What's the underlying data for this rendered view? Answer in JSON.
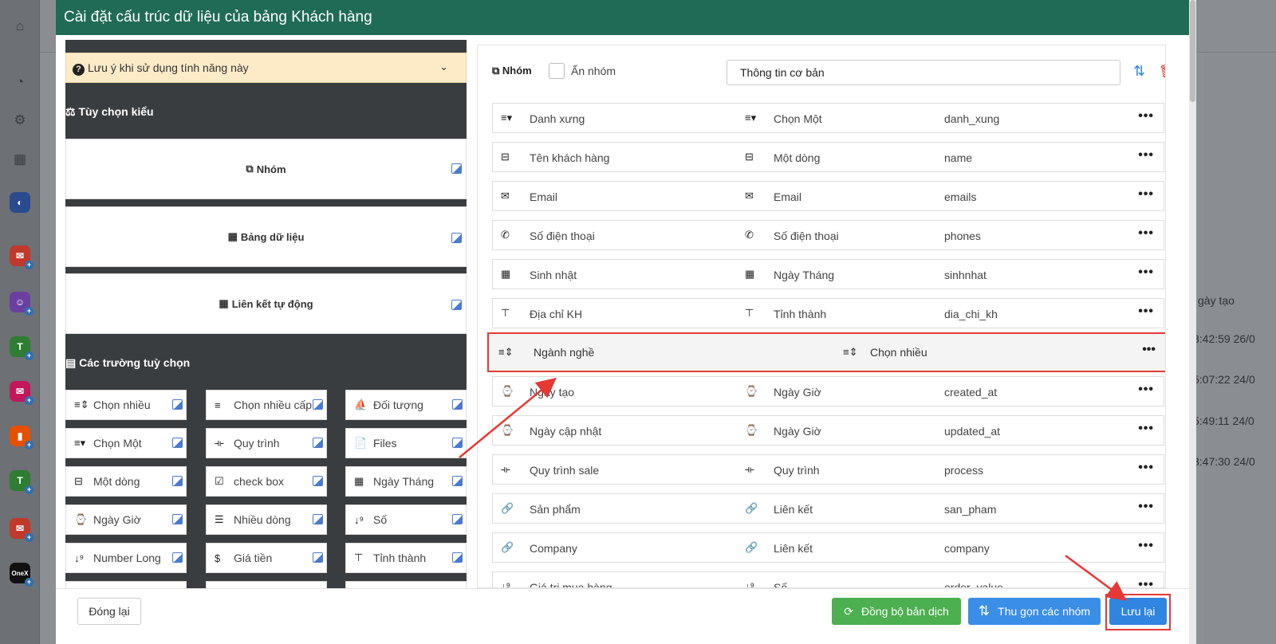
{
  "modal": {
    "title": "Cài đặt cấu trúc dữ liệu của bảng Khách hàng"
  },
  "left_panel": {
    "notice": "Lưu ý khi sử dụng tính năng này",
    "type_section_title": "Tùy chọn kiểu",
    "type_cards": [
      {
        "label": "Nhóm",
        "icon": "copy-icon"
      },
      {
        "label": "Bảng dữ liệu",
        "icon": "table-icon"
      },
      {
        "label": "Liên kết tự động",
        "icon": "table-icon"
      }
    ],
    "fields_section_title": "Các trường tuỳ chọn",
    "field_buttons": [
      {
        "label": "Chọn nhiều",
        "icon": "multi-select-icon"
      },
      {
        "label": "Chọn nhiều cấp",
        "icon": "list-icon"
      },
      {
        "label": "Đối tượng",
        "icon": "sailboat-icon"
      },
      {
        "label": "Chọn Một",
        "icon": "single-select-icon"
      },
      {
        "label": "Quy trình",
        "icon": "process-icon"
      },
      {
        "label": "Files",
        "icon": "file-icon"
      },
      {
        "label": "Một dòng",
        "icon": "single-line-icon"
      },
      {
        "label": "check box",
        "icon": "checkbox-icon"
      },
      {
        "label": "Ngày Tháng",
        "icon": "calendar-icon"
      },
      {
        "label": "Ngày Giờ",
        "icon": "watch-icon"
      },
      {
        "label": "Nhiều dòng",
        "icon": "paragraph-icon"
      },
      {
        "label": "Số",
        "icon": "number-sort-icon"
      },
      {
        "label": "Number Long",
        "icon": "number-sort-icon"
      },
      {
        "label": "Giá tiền",
        "icon": "dollar-icon"
      },
      {
        "label": "Tỉnh thành",
        "icon": "signpost-icon"
      }
    ]
  },
  "right_panel": {
    "group_label": "Nhóm",
    "hide_group_label": "Ẩn nhóm",
    "group_name_value": "Thông tin cơ bản",
    "rows": [
      {
        "name": "Danh xưng",
        "type": "Chọn Một",
        "key": "danh_xung",
        "icon": "single-select-icon"
      },
      {
        "name": "Tên khách hàng",
        "type": "Một dòng",
        "key": "name",
        "icon": "single-line-icon"
      },
      {
        "name": "Email",
        "type": "Email",
        "key": "emails",
        "icon": "envelope-icon"
      },
      {
        "name": "Số điện thoại",
        "type": "Số điện thoại",
        "key": "phones",
        "icon": "phone-icon"
      },
      {
        "name": "Sinh nhật",
        "type": "Ngày Tháng",
        "key": "sinhnhat",
        "icon": "calendar-icon"
      },
      {
        "name": "Địa chỉ KH",
        "type": "Tỉnh thành",
        "key": "dia_chi_kh",
        "icon": "signpost-icon"
      },
      {
        "name": "Ngày tạo",
        "type": "Ngày Giờ",
        "key": "created_at",
        "icon": "watch-icon"
      },
      {
        "name": "Ngày cập nhật",
        "type": "Ngày Giờ",
        "key": "updated_at",
        "icon": "watch-icon"
      },
      {
        "name": "Quy trình sale",
        "type": "Quy trình",
        "key": "process",
        "icon": "process-icon"
      },
      {
        "name": "Sản phẩm",
        "type": "Liên kết",
        "key": "san_pham",
        "icon": "link-icon"
      },
      {
        "name": "Company",
        "type": "Liên kết",
        "key": "company",
        "icon": "link-icon"
      },
      {
        "name": "Giá trị mua hàng",
        "type": "Số",
        "key": "order_value",
        "icon": "number-sort-icon"
      }
    ],
    "highlighted_row": {
      "name": "Ngành nghề",
      "type": "Chọn nhiều",
      "icon": "multi-select-icon"
    }
  },
  "footer": {
    "close_label": "Đóng lại",
    "sync_label": "Đồng bộ bản dịch",
    "collapse_label": "Thu gọn các nhóm",
    "save_label": "Lưu lại"
  },
  "background": {
    "column_header": "gày tạo",
    "times": [
      "3:42:59 26/0",
      "5:07:22 24/0",
      "5:49:11 24/0",
      "8:47:30 24/0"
    ]
  },
  "colors": {
    "header": "#1f6b56",
    "sync": "#4caf50",
    "primary": "#2f85df",
    "highlight": "#e53935"
  }
}
